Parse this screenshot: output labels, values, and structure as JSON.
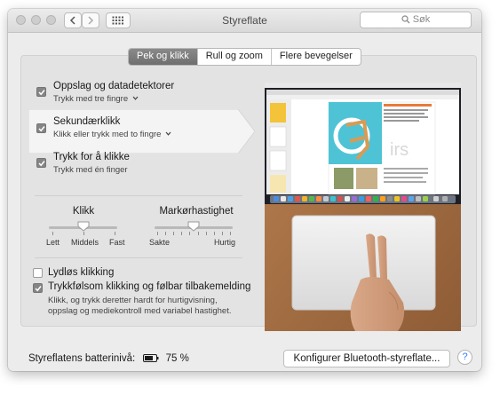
{
  "window": {
    "title": "Styreflate",
    "search_placeholder": "Søk",
    "nav": {
      "back_icon": "chevron-left-icon",
      "forward_icon": "chevron-right-icon",
      "grid_icon": "grid-icon"
    }
  },
  "tabs": [
    {
      "label": "Pek og klikk",
      "active": true
    },
    {
      "label": "Rull og zoom",
      "active": false
    },
    {
      "label": "Flere bevegelser",
      "active": false
    }
  ],
  "options": [
    {
      "title": "Oppslag og datadetektorer",
      "subtitle": "Trykk med tre fingre",
      "checked": true,
      "has_menu": true
    },
    {
      "title": "Sekundærklikk",
      "subtitle": "Klikk eller trykk med to fingre",
      "checked": true,
      "has_menu": true,
      "selected": true
    },
    {
      "title": "Trykk for å klikke",
      "subtitle": "Trykk med én finger",
      "checked": true,
      "has_menu": false
    }
  ],
  "sliders": {
    "click": {
      "label": "Klikk",
      "ticks": [
        "Lett",
        "Middels",
        "Fast"
      ],
      "value_index": 1
    },
    "tracking": {
      "label": "Markørhastighet",
      "min_label": "Sakte",
      "max_label": "Hurtig",
      "value": 0.5
    }
  },
  "checkboxes": {
    "silent": {
      "label": "Lydløs klikking",
      "checked": false
    },
    "force": {
      "label": "Trykkfølsom klikking og følbar tilbakemelding",
      "checked": true,
      "description_line1": "Klikk, og trykk deretter hardt for hurtigvisning,",
      "description_line2": "oppslag og mediekontroll med variabel hastighet."
    }
  },
  "footer": {
    "battery_label": "Styreflatens batterinivå:",
    "battery_value": "75 %",
    "battery_level": 0.75,
    "configure_button": "Konfigurer Bluetooth-styreflate...",
    "help": "?"
  },
  "colors": {
    "accent_active_tab": "#7a7a7a",
    "help_blue": "#2f7cf6",
    "desktop_wood": "#a87447"
  }
}
